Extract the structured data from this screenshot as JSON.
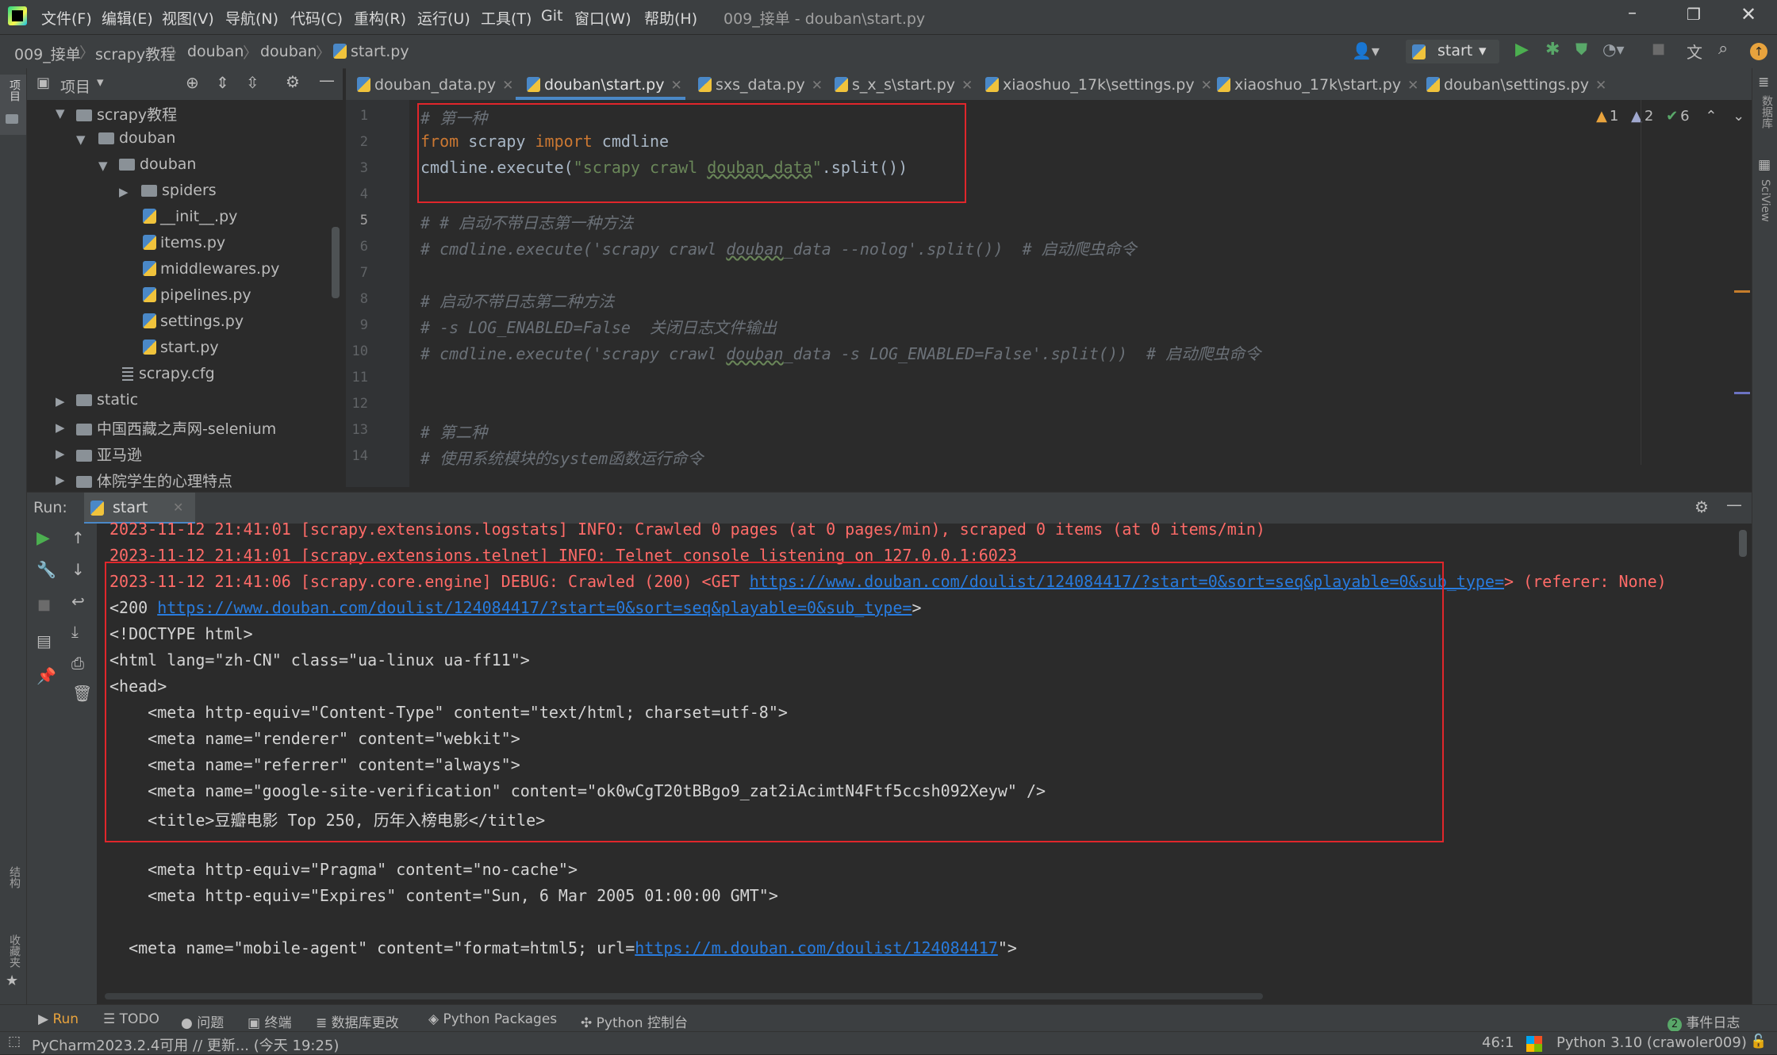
{
  "menu": {
    "items": [
      "文件(F)",
      "编辑(E)",
      "视图(V)",
      "导航(N)",
      "代码(C)",
      "重构(R)",
      "运行(U)",
      "工具(T)",
      "Git",
      "窗口(W)",
      "帮助(H)"
    ],
    "window_title": "009_接单 - douban\\start.py"
  },
  "breadcrumb": [
    "009_接单",
    "scrapy教程",
    "douban",
    "douban",
    "start.py"
  ],
  "run_config": "start",
  "project_panel": {
    "title": "项目",
    "tree": [
      "scrapy教程",
      "douban",
      "douban",
      "spiders",
      "__init__.py",
      "items.py",
      "middlewares.py",
      "pipelines.py",
      "settings.py",
      "start.py",
      "scrapy.cfg",
      "static",
      "中国西藏之声网-selenium",
      "亚马逊",
      "体院学生的心理特点"
    ]
  },
  "tabs": [
    "douban_data.py",
    "douban\\start.py",
    "sxs_data.py",
    "s_x_s\\start.py",
    "xiaoshuo_17k\\settings.py",
    "xiaoshuo_17k\\start.py",
    "douban\\settings.py"
  ],
  "inspections": {
    "warnings": "1",
    "weak_warnings": "2",
    "ok": "6"
  },
  "line_numbers": [
    "1",
    "2",
    "3",
    "4",
    "5",
    "6",
    "7",
    "8",
    "9",
    "10",
    "11",
    "12",
    "13",
    "14"
  ],
  "code": {
    "l1": "# 第一种",
    "l2_from": "from",
    "l2_mod": " scrapy ",
    "l2_import": "import",
    "l2_name": " cmdline",
    "l3_a": "cmdline.execute(",
    "l3_str1": "\"scrapy crawl ",
    "l3_sq": "douban_data",
    "l3_str2": "\"",
    "l3_b": ".split())",
    "l5": "# # 启动不带日志第一种方法",
    "l6a": "# cmdline.execute('scrapy crawl ",
    "l6sq": "douban",
    "l6b": "_data --nolog'.split())  # 启动爬虫命令",
    "l8": "# 启动不带日志第二种方法",
    "l9": "# -s LOG_ENABLED=False  关闭日志文件输出",
    "l10a": "# cmdline.execute('scrapy crawl ",
    "l10sq": "douban",
    "l10b": "_data -s LOG_ENABLED=False'.split())  # 启动爬虫命令",
    "l13": "# 第二种",
    "l14": "# 使用系统模块的system函数运行命令"
  },
  "run": {
    "label": "Run:",
    "tab": "start",
    "lines": {
      "c1": "2023-11-12 21:41:01 [scrapy.extensions.logstats] INFO: Crawled 0 pages (at 0 pages/min), scraped 0 items (at 0 items/min)",
      "c2": "2023-11-12 21:41:01 [scrapy.extensions.telnet] INFO: Telnet console listening on 127.0.0.1:6023",
      "c3a": "2023-11-12 21:41:06 [scrapy.core.engine] DEBUG: Crawled (200) <GET ",
      "c3link": "https://www.douban.com/doulist/124084417/?start=0&sort=seq&playable=0&sub_type=",
      "c3b": "> (referer: None)",
      "c4a": "<200 ",
      "c4link": "https://www.douban.com/doulist/124084417/?start=0&sort=seq&playable=0&sub_type=",
      "c4b": ">",
      "c5": "<!DOCTYPE html>",
      "c6": "<html lang=\"zh-CN\" class=\"ua-linux ua-ff11\">",
      "c7": "<head>",
      "c8": "    <meta http-equiv=\"Content-Type\" content=\"text/html; charset=utf-8\">",
      "c9": "    <meta name=\"renderer\" content=\"webkit\">",
      "c10": "    <meta name=\"referrer\" content=\"always\">",
      "c11": "    <meta name=\"google-site-verification\" content=\"ok0wCgT20tBBgo9_zat2iAcimtN4Ftf5ccsh092Xeyw\" />",
      "c12": "    <title>豆瓣电影 Top 250, 历年入榜电影</title>",
      "c14": "    <meta http-equiv=\"Pragma\" content=\"no-cache\">",
      "c15": "    <meta http-equiv=\"Expires\" content=\"Sun, 6 Mar 2005 01:00:00 GMT\">",
      "c17a": "  <meta name=\"mobile-agent\" content=\"format=html5; url=",
      "c17link": "https://m.douban.com/doulist/124084417",
      "c17b": "\">"
    }
  },
  "bottom_tools": [
    "Run",
    "TODO",
    "问题",
    "终端",
    "数据库更改",
    "Python Packages",
    "Python 控制台"
  ],
  "event_log": {
    "count": "2",
    "label": "事件日志"
  },
  "status": {
    "message": "PyCharm2023.2.4可用 // 更新... (今天 19:25)",
    "position": "46:1",
    "interpreter": "Python 3.10 (crawoler009)"
  },
  "side_labels": {
    "left_top": "项目",
    "left_structure": "结构",
    "left_bookmarks": "收藏夹",
    "right_db": "数据库",
    "right_sciview": "SciView"
  },
  "colors": {
    "highlight_box": "#e0262b",
    "error_text": "#ff6b68",
    "link": "#287bde",
    "keyword": "#cc7832",
    "string": "#6a8759"
  }
}
